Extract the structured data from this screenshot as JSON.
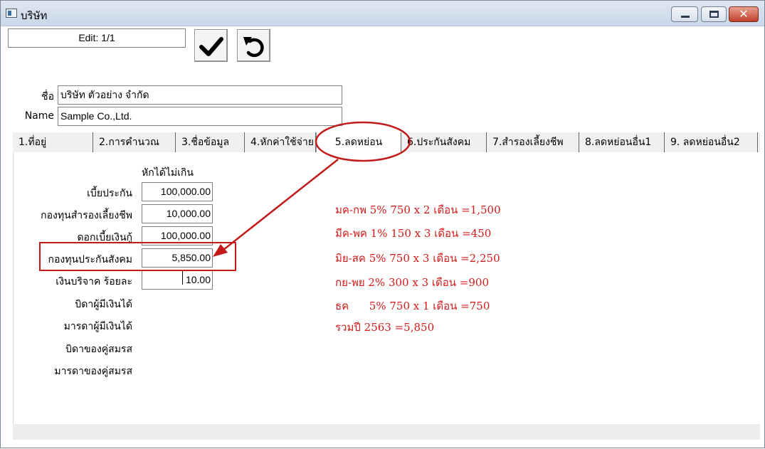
{
  "window": {
    "title": "บริษัท",
    "colors": {
      "titlebar": "#c9d7e8",
      "close": "#c2402a",
      "annotation": "#d21a1a"
    },
    "controls": [
      "minimize-icon",
      "maximize-icon",
      "close-icon"
    ]
  },
  "toolbar": {
    "edit_status": "Edit: 1/1",
    "save_icon": "check-icon",
    "undo_icon": "undo-icon"
  },
  "company": {
    "name_th_label": "ชื่อ",
    "name_th_value": "บริษัท ตัวอย่าง จำกัด",
    "name_en_label": "Name",
    "name_en_value": "Sample Co.,Ltd."
  },
  "tabs": [
    {
      "label": "1.ที่อยู่"
    },
    {
      "label": "2.การคำนวณ"
    },
    {
      "label": "3.ชื่อข้อมูล"
    },
    {
      "label": "4.หักค่าใช้จ่าย"
    },
    {
      "label": "5.ลดหย่อน"
    },
    {
      "label": "6.ประกันสังคม"
    },
    {
      "label": "7.สำรองเลี้ยงชีพ"
    },
    {
      "label": "8.ลดหย่อนอื่น1"
    },
    {
      "label": "9. ลดหย่อนอื่น2"
    }
  ],
  "active_tab": "5.ลดหย่อน",
  "deductions": {
    "column_header": "หักได้ไม่เกิน",
    "rows": [
      {
        "label": "เบี้ยประกัน",
        "value": "100,000.00"
      },
      {
        "label": "กองทุนสำรองเลี้ยงชีพ",
        "value": "10,000.00"
      },
      {
        "label": "ดอกเบี้ยเงินกู้",
        "value": "100,000.00"
      },
      {
        "label": "กองทุนประกันสังคม",
        "value": "5,850.00"
      },
      {
        "label": "เงินบริจาค ร้อยละ",
        "value": "10.00"
      },
      {
        "label": "บิดาผู้มีเงินได้",
        "value": ""
      },
      {
        "label": "มารดาผู้มีเงินได้",
        "value": ""
      },
      {
        "label": "บิดาของคู่สมรส",
        "value": ""
      },
      {
        "label": "มารดาของคู่สมรส",
        "value": ""
      }
    ]
  },
  "annotation_notes": [
    "มค-กพ 5% 750 x 2 เดือน =1,500",
    "มีค-พค 1% 150 x 3 เดือน =450",
    "มิย-สค 5% 750 x 3 เดือน =2,250",
    "กย-พย 2% 300 x 3 เดือน =900",
    "ธค      5% 750 x 1 เดือน =750",
    "รวมปี 2563 =5,850"
  ]
}
